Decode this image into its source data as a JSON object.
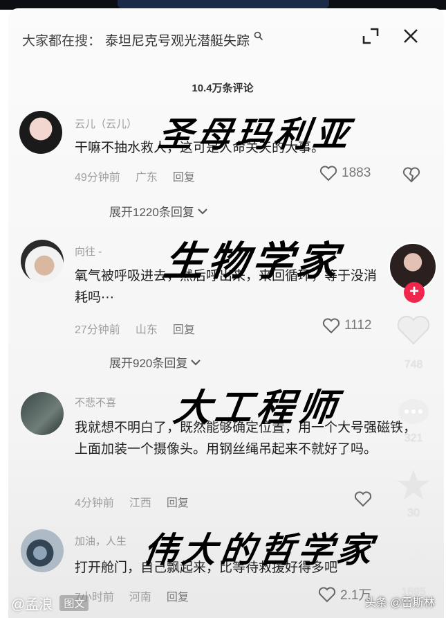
{
  "search": {
    "prefix": "大家都在搜：",
    "query": "泰坦尼克号观光潜艇失踪"
  },
  "comment_count": "10.4万条评论",
  "comments": [
    {
      "username": "云儿（云儿）",
      "text": "干嘛不抽水救人，这可是人命关天的大事。",
      "time": "49分钟前",
      "location": "广东",
      "reply": "回复",
      "likes": "1883",
      "expand": "展开1220条回复"
    },
    {
      "username": "向往 -",
      "text": "氧气被呼吸进去，然后呼出来，来回循环，等于没消耗吗⋯",
      "time": "27分钟前",
      "location": "山东",
      "reply": "回复",
      "likes": "1112",
      "expand": "展开920条回复"
    },
    {
      "username": "不悲不喜",
      "text": "我就想不明白了，既然能够确定位置，用一个大号强磁铁，上面加装一个摄像头。用钢丝绳吊起来不就好了吗。",
      "time": "4分钟前",
      "location": "江西",
      "reply": "回复",
      "likes": ""
    },
    {
      "username": "加油，人生",
      "text": "打开舱门，自己飘起来，比等待救援好得多吧",
      "time": "7小时前",
      "location": "河南",
      "reply": "回复",
      "likes": "2.1万"
    }
  ],
  "overlays": [
    "圣母玛利亚",
    "生物学家",
    "大工程师",
    "伟大的哲学家"
  ],
  "side": {
    "likes": "748",
    "comments": "321",
    "favorites": "30",
    "shares": "1695"
  },
  "author": "@孟浪",
  "tag": "图文",
  "watermark": "头条 @雷斯林",
  "colors": {
    "plus": "#f0264c",
    "text": "#1f1f1f",
    "meta": "#9f9f9f"
  },
  "icons": [
    "search-icon",
    "expand-icon",
    "close-icon",
    "heart-icon",
    "broken-heart-icon",
    "chevron-down-icon",
    "plus-icon",
    "comment-icon",
    "star-icon",
    "share-icon"
  ]
}
